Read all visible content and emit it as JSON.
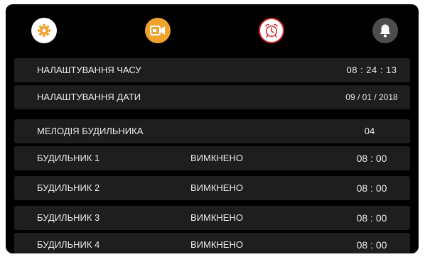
{
  "toolbar": {
    "colors": {
      "settings_bg": "#ffffff",
      "settings_icon": "#f0a22e",
      "video_bg": "#f0a22e",
      "alarm_border": "#d2232a",
      "bell_bg": "#4d4d4d"
    },
    "icons": [
      "gear-icon",
      "video-camera-icon",
      "alarm-clock-icon",
      "bell-icon"
    ]
  },
  "settings": {
    "time": {
      "label": "НАЛАШТУВАННЯ ЧАСУ",
      "value": "08 : 24 : 13"
    },
    "date": {
      "label": "НАЛАШТУВАННЯ ДАТИ",
      "value": "09 / 01 / 2018"
    },
    "melody": {
      "label": "МЕЛОДІЯ БУДИЛЬНИКА",
      "value": "04"
    }
  },
  "alarms": [
    {
      "label": "БУДИЛЬНИК 1",
      "status": "ВИМКНЕНО",
      "time": "08  :  00"
    },
    {
      "label": "БУДИЛЬНИК 2",
      "status": "ВИМКНЕНО",
      "time": "08  :  00"
    },
    {
      "label": "БУДИЛЬНИК 3",
      "status": "ВИМКНЕНО",
      "time": "08  :  00"
    },
    {
      "label": "БУДИЛЬНИК 4",
      "status": "ВИМКНЕНО",
      "time": "08  :  00"
    }
  ]
}
